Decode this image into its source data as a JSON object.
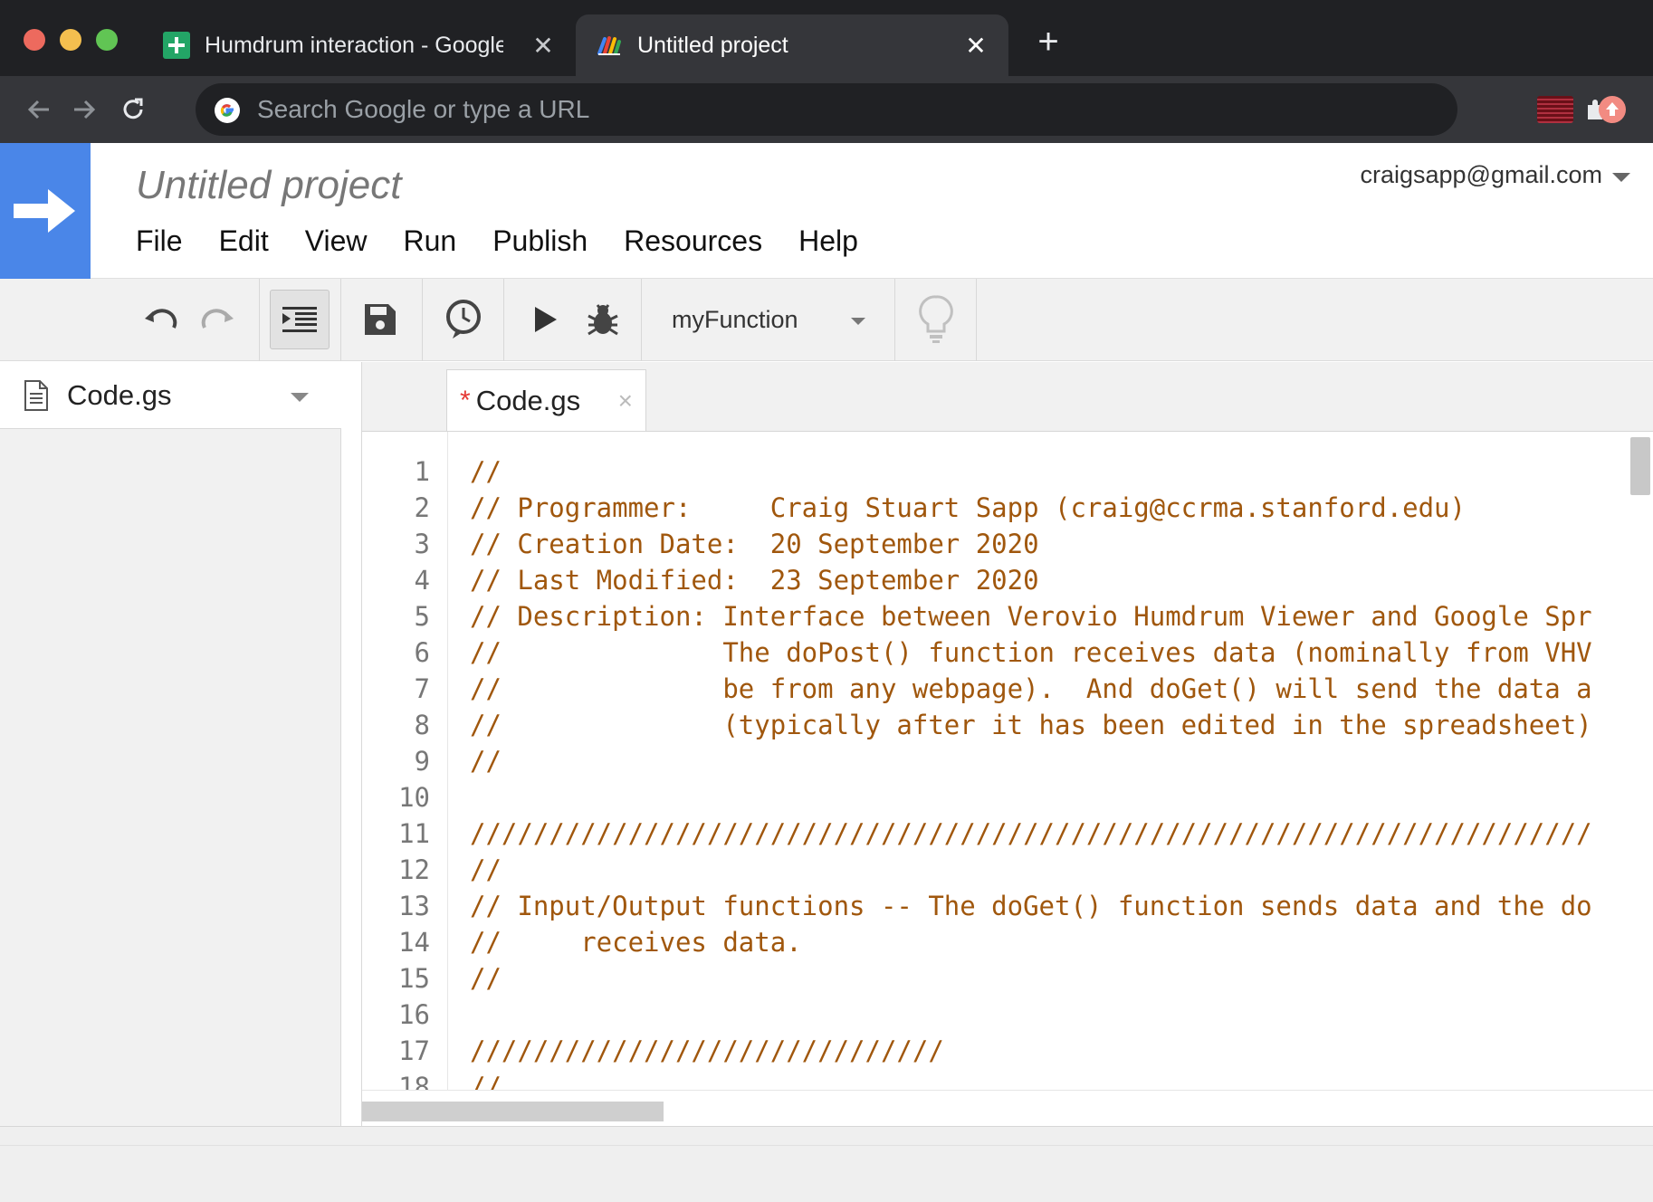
{
  "browser": {
    "tabs": [
      {
        "title": "Humdrum interaction - Google Sheets",
        "favicon": "sheets-icon",
        "active": false
      },
      {
        "title": "Untitled project",
        "favicon": "apps-script-icon",
        "active": true
      }
    ],
    "new_tab_label": "+",
    "omnibox": {
      "placeholder": "Search Google or type a URL",
      "value": ""
    }
  },
  "app": {
    "project_title": "Untitled project",
    "account": "craigsapp@gmail.com",
    "menu": [
      "File",
      "Edit",
      "View",
      "Run",
      "Publish",
      "Resources",
      "Help"
    ],
    "accent_color": "#4a86e8"
  },
  "toolbar": {
    "selected_function": "myFunction"
  },
  "files": [
    {
      "name": "Code.gs"
    }
  ],
  "editor": {
    "tab_label": "Code.gs",
    "modified_marker": "*",
    "close_label": "×",
    "comment_color": "#a0570d",
    "lines": [
      {
        "n": "1",
        "text": "//"
      },
      {
        "n": "2",
        "text": "// Programmer:     Craig Stuart Sapp (craig@ccrma.stanford.edu)"
      },
      {
        "n": "3",
        "text": "// Creation Date:  20 September 2020"
      },
      {
        "n": "4",
        "text": "// Last Modified:  23 September 2020"
      },
      {
        "n": "5",
        "text": "// Description: Interface between Verovio Humdrum Viewer and Google Spr"
      },
      {
        "n": "6",
        "text": "//              The doPost() function receives data (nominally from VHV"
      },
      {
        "n": "7",
        "text": "//              be from any webpage).  And doGet() will send the data a"
      },
      {
        "n": "8",
        "text": "//              (typically after it has been edited in the spreadsheet)"
      },
      {
        "n": "9",
        "text": "//"
      },
      {
        "n": "10",
        "text": ""
      },
      {
        "n": "11",
        "text": "///////////////////////////////////////////////////////////////////////"
      },
      {
        "n": "12",
        "text": "//"
      },
      {
        "n": "13",
        "text": "// Input/Output functions -- The doGet() function sends data and the do"
      },
      {
        "n": "14",
        "text": "//     receives data."
      },
      {
        "n": "15",
        "text": "//"
      },
      {
        "n": "16",
        "text": ""
      },
      {
        "n": "17",
        "text": "//////////////////////////////"
      },
      {
        "n": "18",
        "text": "//"
      }
    ]
  }
}
